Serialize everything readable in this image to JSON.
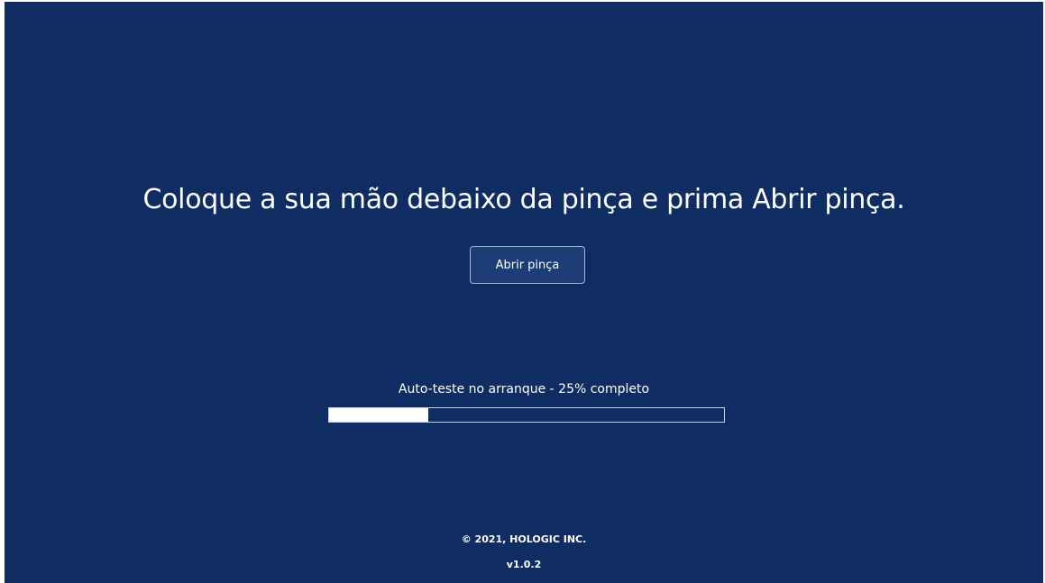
{
  "instruction": "Coloque a sua mão debaixo da pinça e prima Abrir pinça.",
  "open_button_label": "Abrir pinça",
  "progress": {
    "label": "Auto-teste no arranque - 25% completo",
    "percent": 25
  },
  "footer": {
    "copyright": "© 2021, HOLOGIC INC.",
    "version": "v1.0.2"
  },
  "colors": {
    "background": "#0f2d62",
    "text": "#ffffff",
    "progress_fill": "#ffffff"
  }
}
